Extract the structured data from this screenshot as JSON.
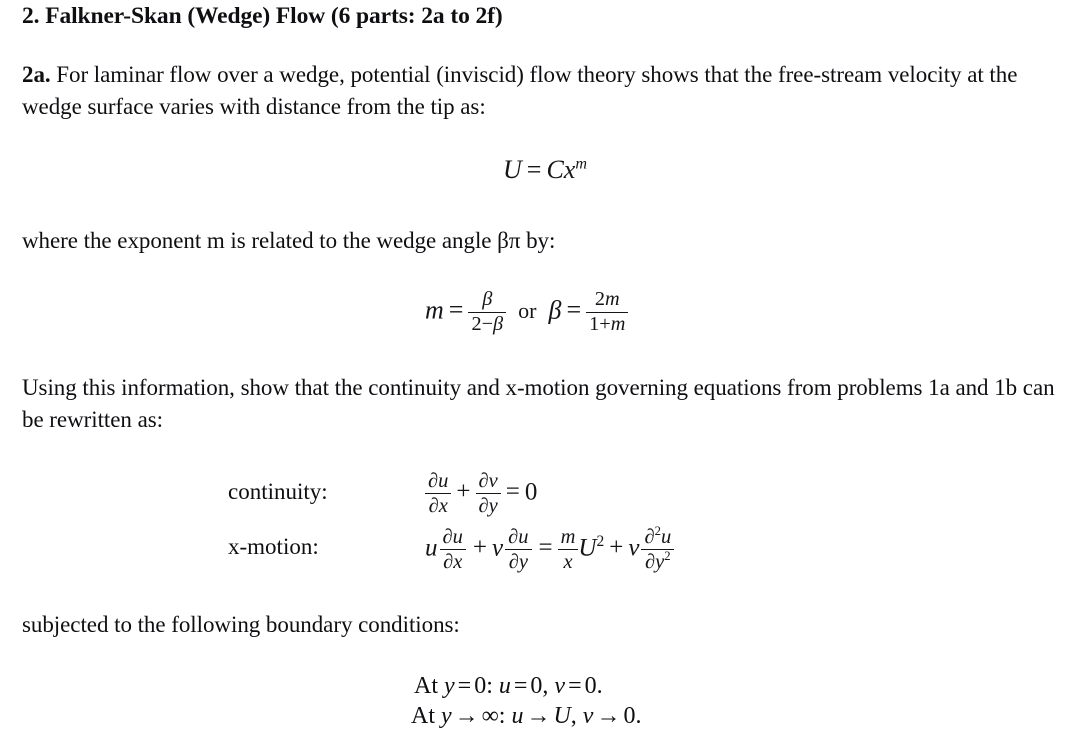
{
  "document": {
    "heading": "2. Falkner-Skan (Wedge) Flow (6 parts: 2a to 2f)",
    "part_2a": {
      "lead": "2a.",
      "body": " For laminar flow over a wedge, potential (inviscid) flow theory shows that the free-stream velocity at the wedge surface varies with distance from the tip as:",
      "equation_velocity": {
        "lhs": "U",
        "equals": "=",
        "rhs_coefficient": "C",
        "rhs_variable": "x",
        "rhs_exponent": "m",
        "plain": "U = Cx^m"
      },
      "exponent_note": "where the exponent m is related to the wedge angle βπ by:",
      "equation_m_beta": {
        "m_symbol": "m",
        "equals": "=",
        "m_numerator": "β",
        "m_denominator_left": "2",
        "m_denominator_minus": "−",
        "m_denominator_right": "β",
        "conjunction": "or",
        "beta_symbol": "β",
        "beta_numerator_coefficient": "2",
        "beta_numerator_variable": "m",
        "beta_denominator_left": "1",
        "beta_denominator_plus": "+",
        "beta_denominator_right": "m",
        "plain": "m = β/(2−β)  or  β = 2m/(1+m)"
      },
      "instruction": "Using this information, show that the continuity and x-motion governing equations from problems 1a and 1b can be rewritten as:",
      "governing_equations": {
        "continuity_label": "continuity:",
        "continuity": {
          "term1_num": "∂u",
          "term1_den": "∂x",
          "plus": "+",
          "term2_num": "∂v",
          "term2_den": "∂y",
          "equals": "=",
          "rhs": "0",
          "plain": "∂u/∂x + ∂v/∂y = 0"
        },
        "xmotion_label": "x-motion:",
        "xmotion": {
          "u": "u",
          "term1_num": "∂u",
          "term1_den": "∂x",
          "plus": "+",
          "v": "v",
          "term2_num": "∂u",
          "term2_den": "∂y",
          "equals": "=",
          "m_over_x_num": "m",
          "m_over_x_den": "x",
          "U": "U",
          "U_exponent": "2",
          "plus2": "+",
          "nu": "ν",
          "term3_num": "∂",
          "term3_num_exp": "2",
          "term3_num_var": "u",
          "term3_den": "∂y",
          "term3_den_exp": "2",
          "plain": "u ∂u/∂x + v ∂u/∂y = (m/x)U² + ν ∂²u/∂y²"
        }
      },
      "bc_intro": "subjected to the following boundary conditions:",
      "boundary_conditions": {
        "line1": {
          "at": "At",
          "var": "y",
          "relation": "=",
          "value": "0",
          "colon": ":",
          "u": "u",
          "u_eq": "=",
          "u_val": "0",
          "comma": ",",
          "v": "v",
          "v_eq": "=",
          "v_val": "0",
          "period": ".",
          "plain": "At y = 0: u = 0, v = 0."
        },
        "line2": {
          "at": "At",
          "var": "y",
          "relation": "→",
          "value": "∞",
          "colon": ":",
          "u": "u",
          "u_eq": "→",
          "u_val": "U",
          "comma": ",",
          "v": "v",
          "v_eq": "→",
          "v_val": "0",
          "period": ".",
          "plain": "At y → ∞: u → U, v → 0."
        }
      }
    }
  },
  "style": {
    "text_color": "#0f0f13",
    "background_color": "#ffffff"
  }
}
